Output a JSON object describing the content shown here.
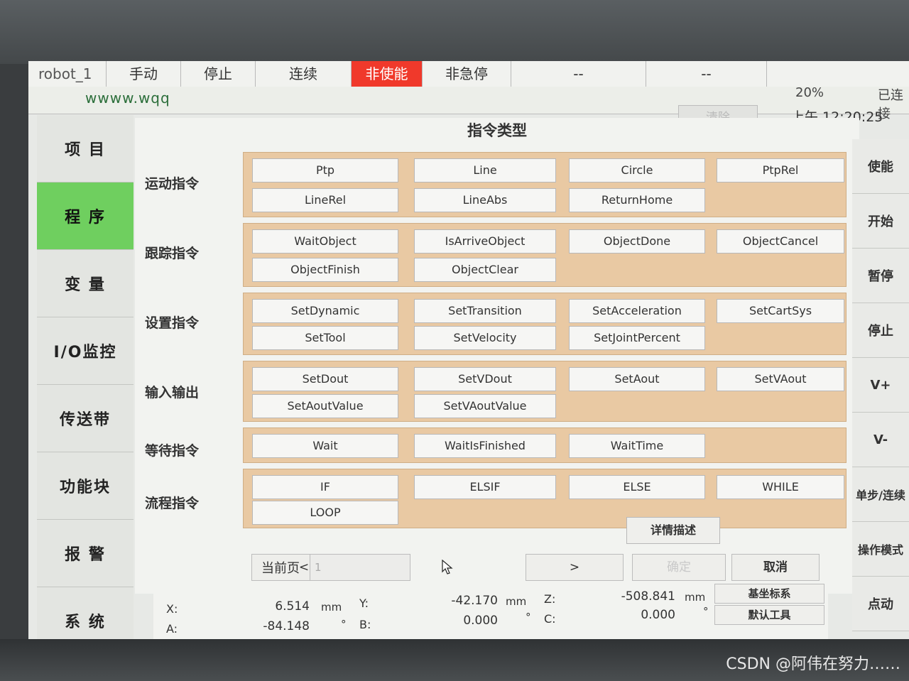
{
  "topbar": {
    "robot": "robot_1",
    "mode": "手动",
    "stop": "停止",
    "continuous": "连续",
    "disable": "非使能",
    "not_estop": "非急停",
    "dash1": "--",
    "dash2": "--",
    "percent": "20%",
    "connected": "已连接",
    "site": "wwww.wqq",
    "clear": "清除",
    "time": "上午 12:20:25"
  },
  "nav": [
    "项 目",
    "程 序",
    "变 量",
    "I/O监控",
    "传送带",
    "功能块",
    "报 警",
    "系 统"
  ],
  "main": {
    "title": "指令类型",
    "categories": [
      {
        "label": "运动指令",
        "commands": [
          "Ptp",
          "Line",
          "Circle",
          "PtpRel",
          "LineRel",
          "LineAbs",
          "ReturnHome"
        ]
      },
      {
        "label": "跟踪指令",
        "commands": [
          "WaitObject",
          "IsArriveObject",
          "ObjectDone",
          "ObjectCancel",
          "ObjectFinish",
          "ObjectClear"
        ]
      },
      {
        "label": "设置指令",
        "commands": [
          "SetDynamic",
          "SetTransition",
          "SetAcceleration",
          "SetCartSys",
          "SetTool",
          "SetVelocity",
          "SetJointPercent"
        ]
      },
      {
        "label": "输入输出",
        "commands": [
          "SetDout",
          "SetVDout",
          "SetAout",
          "SetVAout",
          "SetAoutValue",
          "SetVAoutValue"
        ]
      },
      {
        "label": "等待指令",
        "commands": [
          "Wait",
          "WaitIsFinished",
          "WaitTime"
        ]
      },
      {
        "label": "流程指令",
        "commands": [
          "IF",
          "ELSIF",
          "ELSE",
          "WHILE",
          "LOOP"
        ]
      }
    ],
    "detail": "详情描述",
    "prev": "<",
    "page_label": "当前页",
    "page_value": "1",
    "next": ">",
    "confirm": "确定",
    "cancel": "取消"
  },
  "coords": {
    "x_label": "X:",
    "x": "6.514",
    "x_unit": "mm",
    "y_label": "Y:",
    "y": "-42.170",
    "y_unit": "mm",
    "z_label": "Z:",
    "z": "-508.841",
    "z_unit": "mm",
    "a_label": "A:",
    "a": "-84.148",
    "a_unit": "°",
    "b_label": "B:",
    "b": "0.000",
    "b_unit": "°",
    "c_label": "C:",
    "c": "0.000",
    "c_unit": "°",
    "base_frame": "基坐标系",
    "default_tool": "默认工具"
  },
  "right": [
    "使能",
    "开始",
    "暂停",
    "停止",
    "V+",
    "V-",
    "单步/连续",
    "操作模式",
    "点动"
  ],
  "watermark": "CSDN @阿伟在努力……",
  "colors": {
    "active_nav": "#6fcf5f",
    "disabled_badge": "#f0392b",
    "group_bg": "#e9c9a3"
  }
}
